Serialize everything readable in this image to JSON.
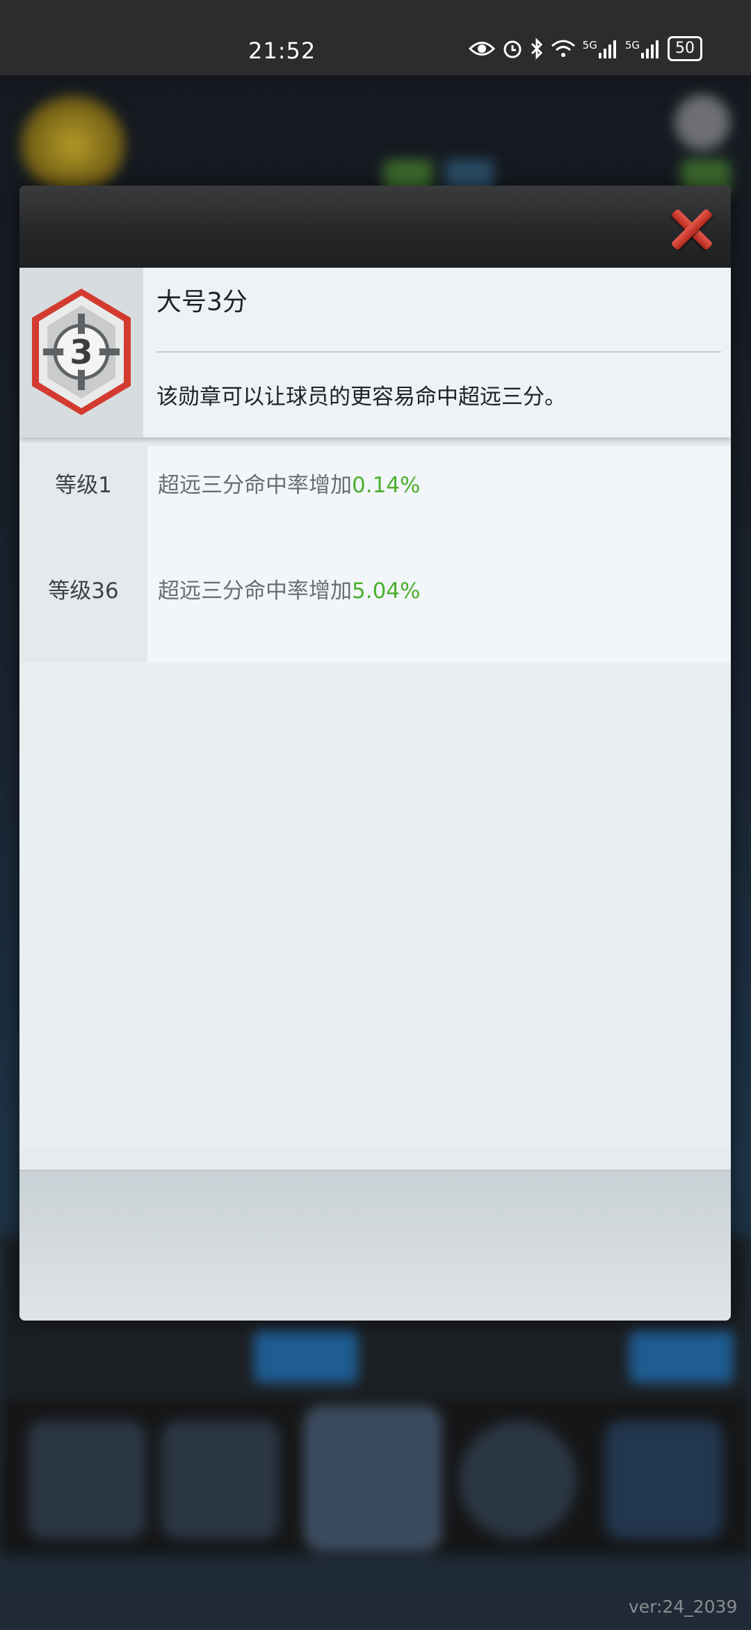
{
  "status_bar": {
    "time": "21:52",
    "signal1": "5G",
    "signal2": "5G",
    "battery": "50"
  },
  "modal": {
    "close_label": "×",
    "badge": {
      "icon": "three-point-badge-icon",
      "icon_number": "3",
      "name": "大号3分",
      "description": "该勋章可以让球员的更容易命中超远三分。"
    },
    "levels": [
      {
        "label": "等级1",
        "effect_text": "超远三分命中率增加",
        "effect_value": "0.14%"
      },
      {
        "label": "等级36",
        "effect_text": "超远三分命中率增加",
        "effect_value": "5.04%"
      }
    ]
  },
  "background": {
    "version": "ver:24_2039"
  },
  "colors": {
    "accent_green": "#4caf2e",
    "close_red": "#c8352a"
  }
}
